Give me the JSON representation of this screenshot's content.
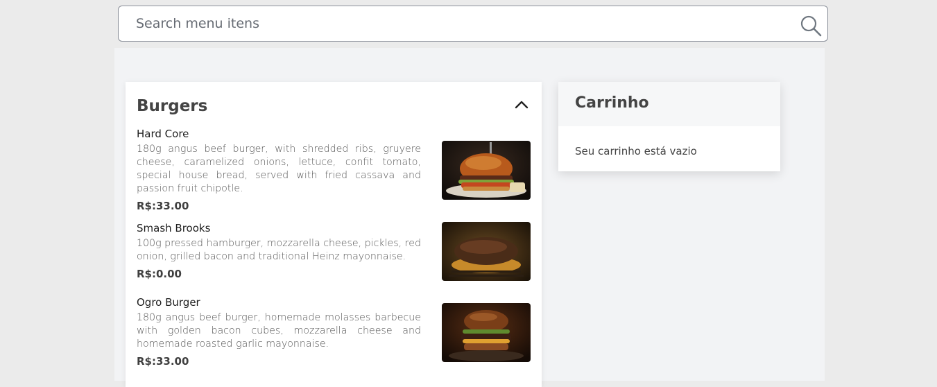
{
  "search": {
    "placeholder": "Search menu itens"
  },
  "menu": {
    "category": "Burgers",
    "items": [
      {
        "name": "Hard Core",
        "description": "180g angus beef burger, with shredded ribs, gruyere cheese, caramelized onions, lettuce, confit tomato, special house bread, served with fried cassava and passion fruit chipotle.",
        "price": "R$:33.00"
      },
      {
        "name": "Smash Brooks",
        "description": "100g pressed hamburger, mozzarella cheese, pickles, red onion, grilled bacon and traditional Heinz mayonnaise.",
        "price": "R$:0.00"
      },
      {
        "name": "Ogro Burger",
        "description": "180g angus beef burger, homemade molasses barbecue with golden bacon cubes, mozzarella cheese and homemade roasted garlic mayonnaise.",
        "price": "R$:33.00"
      }
    ]
  },
  "cart": {
    "title": "Carrinho",
    "empty_message": "Seu carrinho está vazio"
  },
  "icons": {
    "search": "search-icon",
    "collapse": "chevron-up-icon"
  },
  "colors": {
    "page_bg": "#ebebeb",
    "panel_bg": "#f2f3f5",
    "card_bg": "#ffffff",
    "text_dark": "#333333"
  }
}
